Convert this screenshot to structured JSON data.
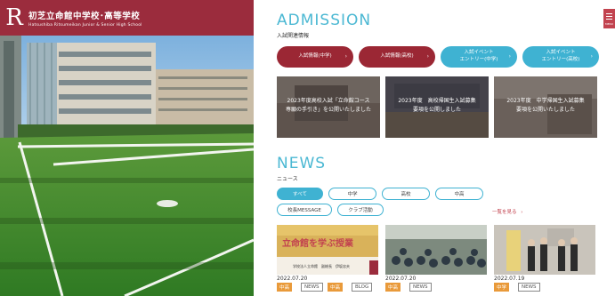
{
  "header": {
    "logo_letter": "R",
    "school_name": "初芝立命館中学校･高等学校",
    "school_name_en": "Hatsushiba Ritsumeikan Junior & Senior High School"
  },
  "menu": {
    "icon": "menu-icon",
    "label": "MENU"
  },
  "admission": {
    "title": "ADMISSION",
    "subtitle": "入試関連情報",
    "buttons": [
      {
        "label": "入試情報(中学)",
        "color": "#9b2734"
      },
      {
        "label": "入試情報(高校)",
        "color": "#9b2734"
      },
      {
        "label": "入試イベント\nエントリー(中学)",
        "color": "#3fb2d2"
      },
      {
        "label": "入試イベント\nエントリー(高校)",
        "color": "#3fb2d2"
      }
    ],
    "cards": [
      {
        "caption": "2023年度高校入試「立命館コース\n専願の手引き」を公開いたしました"
      },
      {
        "caption": "2023年度　高校帰国生入試募集\n要項を公開しました"
      },
      {
        "caption": "2023年度　中学帰国生入試募集\n要項を公開いたしました"
      }
    ]
  },
  "news": {
    "title": "NEWS",
    "subtitle": "ニュース",
    "filters": [
      "すべて",
      "中学",
      "高校",
      "中高",
      "校長MESSAGE",
      "クラブ活動"
    ],
    "more_label": "一覧を見る",
    "more_arrow": "›",
    "items": [
      {
        "date": "2022.07.20",
        "tags": [
          "中高",
          "NEWS",
          "中高",
          "BLOG"
        ],
        "thumb_text": "立命館を学ぶ授業",
        "thumb_sub": "学校法人立命館　副総長　伊坂忠夫"
      },
      {
        "date": "2022.07.20",
        "tags": [
          "中高",
          "NEWS"
        ]
      },
      {
        "date": "2022.07.19",
        "tags": [
          "中学",
          "NEWS"
        ]
      }
    ]
  },
  "colors": {
    "brand_red": "#9b2c3d",
    "accent_blue": "#3fb2d2",
    "tag_orange": "#e99a3a"
  }
}
